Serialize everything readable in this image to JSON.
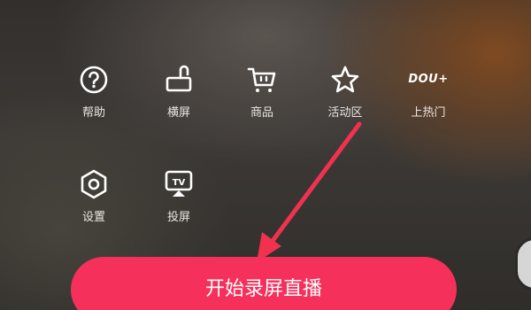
{
  "menu": {
    "row1": [
      {
        "icon": "help-icon",
        "label": "帮助"
      },
      {
        "icon": "landscape-icon",
        "label": "横屏"
      },
      {
        "icon": "cart-icon",
        "label": "商品"
      },
      {
        "icon": "star-icon",
        "label": "活动区"
      },
      {
        "icon": "dou-plus-icon",
        "icon_text": "DOU+",
        "label": "上热门"
      }
    ],
    "row2": [
      {
        "icon": "settings-icon",
        "label": "设置"
      },
      {
        "icon": "tv-cast-icon",
        "icon_text": "TV",
        "label": "投屏"
      }
    ]
  },
  "cta": {
    "label": "开始录屏直播"
  },
  "colors": {
    "cta": "#f5305a",
    "arrow": "#f0324f",
    "icon": "#ffffff"
  }
}
